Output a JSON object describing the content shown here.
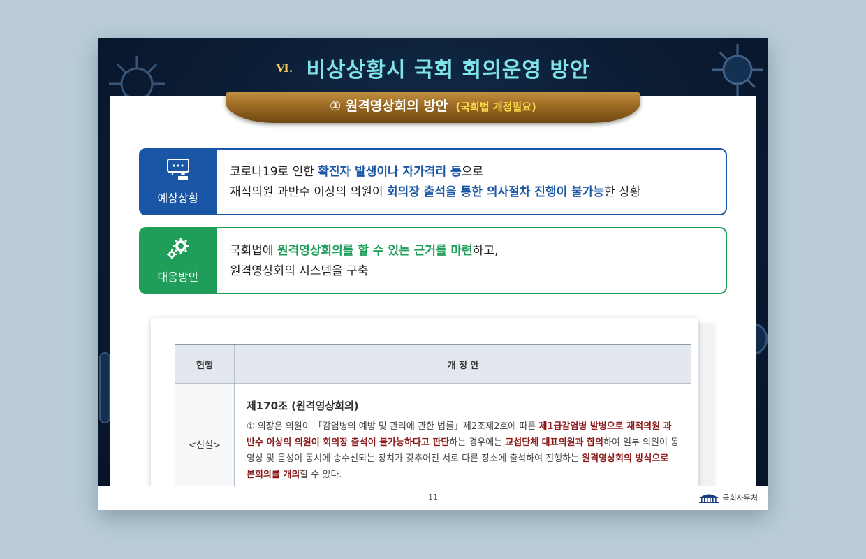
{
  "slide": {
    "section_numeral": "Ⅵ.",
    "title": "비상상황시 국회 회의운영 방안",
    "ribbon": {
      "main": "① 원격영상회의 방안",
      "sub": "(국회법 개정필요)"
    }
  },
  "cards": [
    {
      "label": "예상상황",
      "icon": "video-meeting-icon",
      "line1": [
        "코로나19로 인한 ",
        "확진자 발생이나 자가격리 등",
        "으로"
      ],
      "line2": [
        "재적의원 과반수 이상의 의원이 ",
        "회의장 출석을 통한 의사절차 진행이 불가능",
        "한 상황"
      ]
    },
    {
      "label": "대응방안",
      "icon": "gears-icon",
      "line1": [
        "국회법에 ",
        "원격영상회의를 할 수 있는 근거를 마련",
        "하고,"
      ],
      "line2": [
        "원격영상회의 시스템을 구축"
      ]
    }
  ],
  "table": {
    "headers": [
      "현행",
      "개 정 안"
    ],
    "current": "<신설>",
    "article_title": "제170조 (원격영상회의)",
    "article_body": [
      "① 의장은 의원이 「감염병의 예방 및 관리에 관한 법률」제2조제2호에 따른 ",
      "제1급감염병 발병으로 재적의원 과반수 이상의 의원이 회의장 출석이 불가능하다고 판단",
      "하는 경우에는 ",
      "교섭단체 대표의원과 합의",
      "하여 일부 의원이 동영상 및 음성이 동시에  송수신되는 장치가 갖추어진 서로 다른 장소에 출석하여 진행하는 ",
      "원격영상회의 방식으로 본회의를 개의",
      "할 수 있다."
    ]
  },
  "footer": {
    "page_number": "11",
    "organization": "국회사무처"
  }
}
